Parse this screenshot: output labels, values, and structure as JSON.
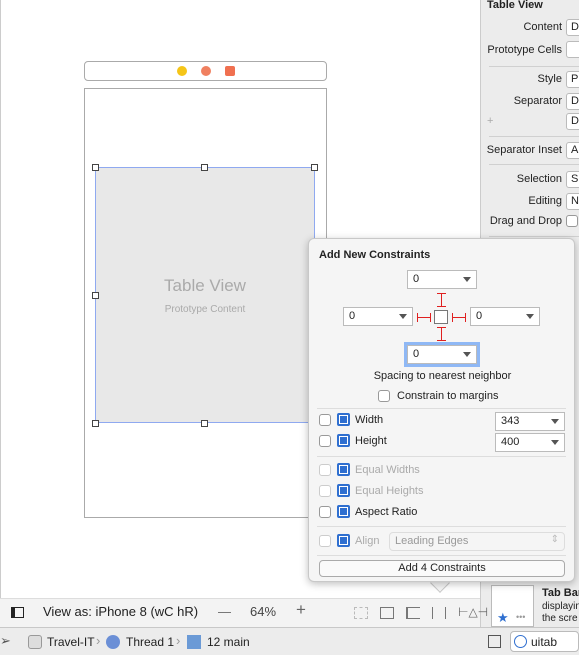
{
  "canvas": {
    "table_view_title": "Table View",
    "table_view_subtitle": "Prototype Content"
  },
  "inspector": {
    "section_title": "Table View",
    "rows": [
      {
        "label": "Content",
        "value": "D"
      },
      {
        "label": "Prototype Cells",
        "value": ""
      },
      {
        "label": "Style",
        "value": "P"
      },
      {
        "label": "Separator",
        "value": "D"
      },
      {
        "label": "+",
        "value": "D"
      },
      {
        "label": "Separator Inset",
        "value": "A"
      },
      {
        "label": "Selection",
        "value": "S"
      },
      {
        "label": "Editing",
        "value": "N"
      },
      {
        "label": "Drag and Drop",
        "value": ""
      }
    ],
    "library_item_title": "Tab Bar",
    "library_item_desc1": "displayin",
    "library_item_desc2": "the scre",
    "filter_value": "uitab"
  },
  "popover": {
    "title": "Add New Constraints",
    "top": "0",
    "left": "0",
    "right": "0",
    "bottom": "0",
    "spacing_label": "Spacing to nearest neighbor",
    "constrain_margins": "Constrain to margins",
    "width_label": "Width",
    "width_value": "343",
    "height_label": "Height",
    "height_value": "400",
    "equal_widths": "Equal Widths",
    "equal_heights": "Equal Heights",
    "aspect_ratio": "Aspect Ratio",
    "align_label": "Align",
    "align_value": "Leading Edges",
    "add_button": "Add 4 Constraints"
  },
  "bottom_bar": {
    "view_as": "View as: iPhone 8 (wC hR)",
    "zoom_out": "—",
    "zoom": "64%",
    "zoom_in": "+"
  },
  "debug_bar": {
    "target": "Travel-IT",
    "thread": "Thread 1",
    "frame": "12 main"
  }
}
